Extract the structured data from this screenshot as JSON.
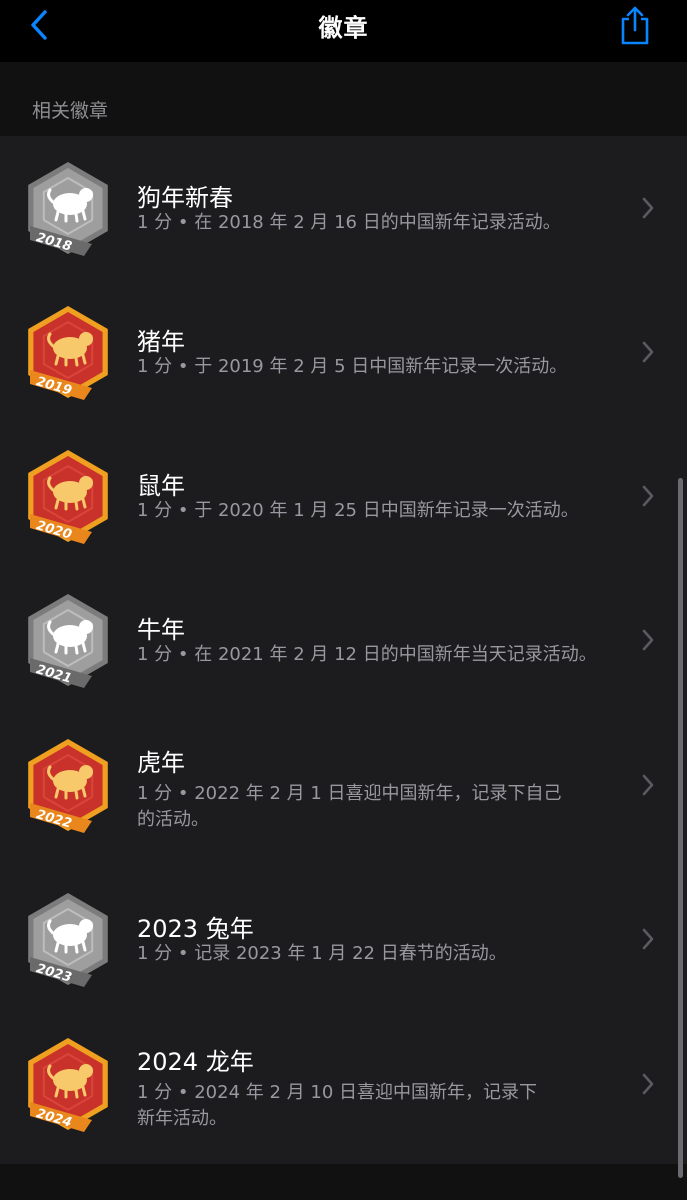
{
  "nav": {
    "title": "徽章",
    "back_icon": "chevron-left-icon",
    "share_icon": "share-icon"
  },
  "section": {
    "header": "相关徽章"
  },
  "colors": {
    "accent": "#0a84ff",
    "background": "#111111",
    "list_bg": "#1c1c1e",
    "silver": "#9a9a9a",
    "red": "#c8322a",
    "gold": "#f0a020"
  },
  "badges": [
    {
      "title": "狗年新春",
      "sub_lines": [
        "1 分 • 在 2018 年 2 月 16 日的中国新年记录活动。"
      ],
      "year": "2018",
      "style": "silver",
      "icon": "dog-icon"
    },
    {
      "title": "猪年",
      "sub_lines": [
        "1 分 • 于 2019 年 2 月 5 日中国新年记录一次活动。"
      ],
      "year": "2019",
      "style": "red",
      "icon": "pig-icon"
    },
    {
      "title": "鼠年",
      "sub_lines": [
        "1 分 • 于 2020 年 1 月 25 日中国新年记录一次活动。"
      ],
      "year": "2020",
      "style": "red",
      "icon": "rat-icon"
    },
    {
      "title": "牛年",
      "sub_lines": [
        "1 分 • 在 2021 年 2 月 12 日的中国新年当天记录活动。"
      ],
      "year": "2021",
      "style": "silver",
      "icon": "ox-icon"
    },
    {
      "title": "虎年",
      "sub_lines": [
        "1 分 • 2022 年 2 月 1 日喜迎中国新年，记录下自己",
        "的活动。"
      ],
      "year": "2022",
      "style": "red",
      "icon": "tiger-icon"
    },
    {
      "title": "2023 兔年",
      "sub_lines": [
        "1 分 • 记录 2023 年 1 月 22 日春节的活动。"
      ],
      "year": "2023",
      "style": "silver",
      "icon": "rabbit-icon"
    },
    {
      "title": "2024 龙年",
      "sub_lines": [
        "1 分 • 2024 年 2 月 10 日喜迎中国新年，记录下",
        "新年活动。"
      ],
      "year": "2024",
      "style": "red",
      "icon": "dragon-icon"
    }
  ]
}
